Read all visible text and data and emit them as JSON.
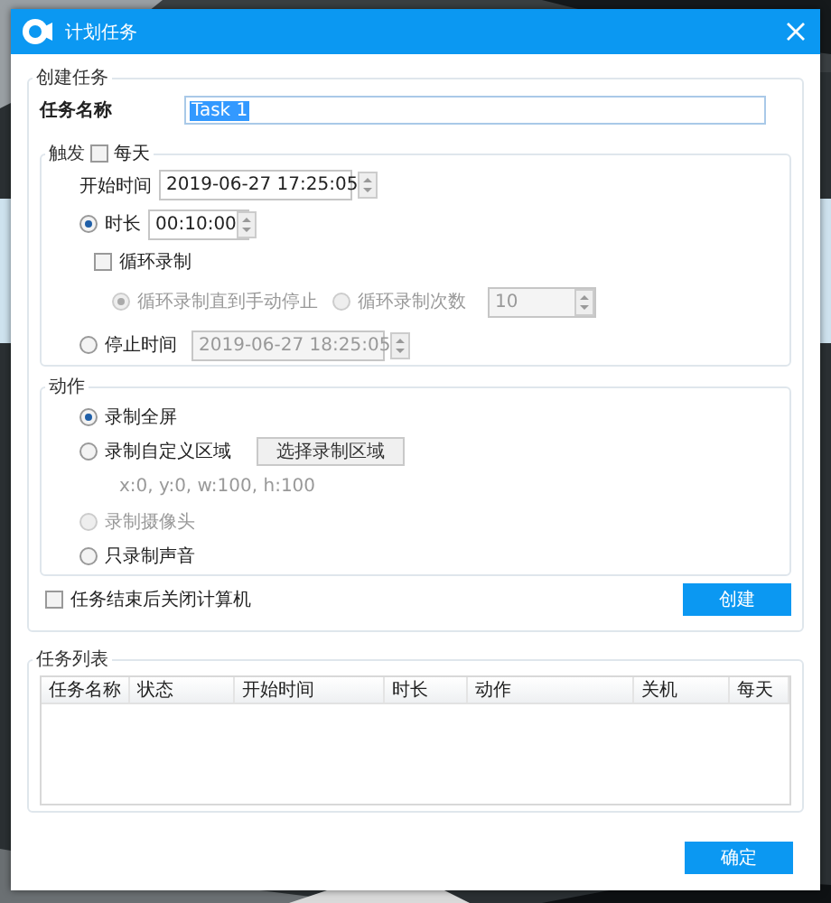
{
  "window": {
    "title": "计划任务"
  },
  "create_group": {
    "legend": "创建任务",
    "task_name_label": "任务名称",
    "task_name": "Task 1",
    "trigger": {
      "legend": "触发",
      "daily": {
        "label": "每天",
        "checked": false
      },
      "start_label": "开始时间",
      "start_time": "2019-06-27 17:25:05",
      "duration": {
        "label": "时长",
        "selected": true,
        "value": "00:10:00"
      },
      "loop": {
        "label": "循环录制",
        "checked": false
      },
      "loop_modes": [
        {
          "label": "循环录制直到手动停止",
          "selected": true,
          "disabled": true
        },
        {
          "label": "循环录制次数",
          "selected": false,
          "disabled": true,
          "value": "10"
        }
      ],
      "stop": {
        "label": "停止时间",
        "selected": false,
        "value": "2019-06-27 18:25:05",
        "disabled": true
      }
    },
    "action": {
      "legend": "动作",
      "options": [
        {
          "label": "录制全屏",
          "selected": true,
          "disabled": false
        },
        {
          "label": "录制自定义区域",
          "selected": false,
          "disabled": false,
          "button": "选择录制区域",
          "note": "x:0, y:0, w:100, h:100"
        },
        {
          "label": "录制摄像头",
          "selected": false,
          "disabled": true
        },
        {
          "label": "只录制声音",
          "selected": false,
          "disabled": false
        }
      ]
    },
    "shutdown": {
      "label": "任务结束后关闭计算机",
      "checked": false
    },
    "create_button": "创建"
  },
  "task_list": {
    "legend": "任务列表",
    "columns": [
      "任务名称",
      "状态",
      "开始时间",
      "时长",
      "动作",
      "关机",
      "每天"
    ]
  },
  "ok_button": "确定"
}
